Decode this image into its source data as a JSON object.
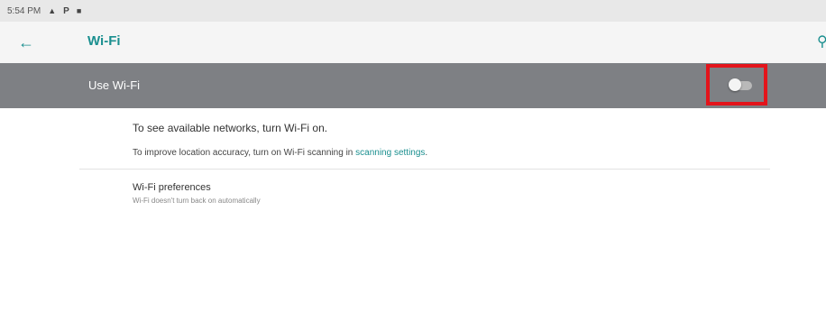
{
  "status_bar": {
    "time": "5:54 PM",
    "icons": [
      "lock-icon",
      "p-icon",
      "briefcase-icon"
    ]
  },
  "app_bar": {
    "title": "Wi-Fi",
    "back_icon": "back-arrow-icon",
    "search_icon": "search-icon"
  },
  "master_switch": {
    "label": "Use Wi-Fi",
    "state": "off",
    "highlight_color": "#e3141b"
  },
  "messages": {
    "off_message": "To see available networks, turn Wi-Fi on.",
    "scanning_prefix": "To improve location accuracy, turn on Wi-Fi scanning in ",
    "scanning_link": "scanning settings",
    "scanning_suffix": "."
  },
  "preferences": {
    "title": "Wi-Fi preferences",
    "summary": "Wi-Fi doesn't turn back on automatically"
  },
  "colors": {
    "accent": "#1a8f8f",
    "master_bar": "#7e8084"
  }
}
